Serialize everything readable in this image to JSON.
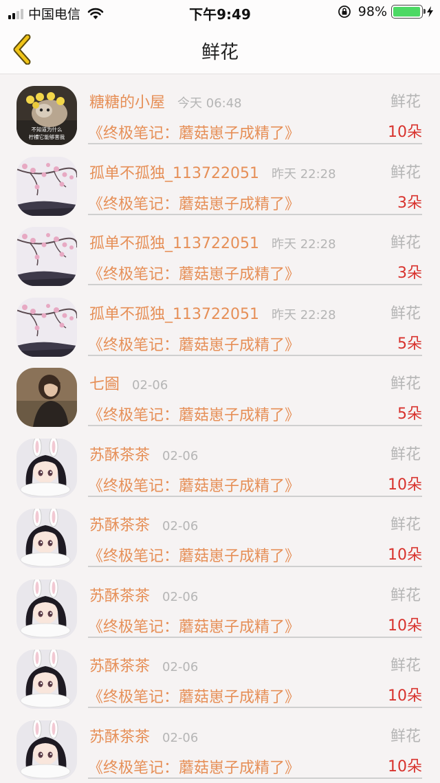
{
  "status_bar": {
    "carrier": "中国电信",
    "time": "下午9:49",
    "battery_percent": "98%",
    "battery_level": 0.98
  },
  "nav": {
    "title": "鲜花",
    "back_icon": "chevron-left-icon"
  },
  "colors": {
    "accent": "#f0c419",
    "username": "#e68f57",
    "count": "#d8322d",
    "muted": "#b5b5b5"
  },
  "rows": [
    {
      "avatar": "photo-dog-lemons",
      "avatar_caption": "不知道为什么 柠檬它能够害我",
      "name": "糖糖的小屋",
      "time": "今天 06:48",
      "gift": "鲜花",
      "book": "《终极笔记：蘑菇崽子成精了》",
      "count": "10朵"
    },
    {
      "avatar": "photo-cherry-blossom",
      "name": "孤单不孤独_113722051",
      "time": "昨天 22:28",
      "gift": "鲜花",
      "book": "《终极笔记：蘑菇崽子成精了》",
      "count": "3朵"
    },
    {
      "avatar": "photo-cherry-blossom",
      "name": "孤单不孤独_113722051",
      "time": "昨天 22:28",
      "gift": "鲜花",
      "book": "《终极笔记：蘑菇崽子成精了》",
      "count": "3朵"
    },
    {
      "avatar": "photo-cherry-blossom",
      "name": "孤单不孤独_113722051",
      "time": "昨天 22:28",
      "gift": "鲜花",
      "book": "《终极笔记：蘑菇崽子成精了》",
      "count": "5朵"
    },
    {
      "avatar": "photo-girl-portrait",
      "name": "七圇",
      "time": "02-06",
      "gift": "鲜花",
      "book": "《终极笔记：蘑菇崽子成精了》",
      "count": "5朵"
    },
    {
      "avatar": "anime-bunny-girl",
      "name": "苏酥茶茶",
      "time": "02-06",
      "gift": "鲜花",
      "book": "《终极笔记：蘑菇崽子成精了》",
      "count": "10朵"
    },
    {
      "avatar": "anime-bunny-girl",
      "name": "苏酥茶茶",
      "time": "02-06",
      "gift": "鲜花",
      "book": "《终极笔记：蘑菇崽子成精了》",
      "count": "10朵"
    },
    {
      "avatar": "anime-bunny-girl",
      "name": "苏酥茶茶",
      "time": "02-06",
      "gift": "鲜花",
      "book": "《终极笔记：蘑菇崽子成精了》",
      "count": "10朵"
    },
    {
      "avatar": "anime-bunny-girl",
      "name": "苏酥茶茶",
      "time": "02-06",
      "gift": "鲜花",
      "book": "《终极笔记：蘑菇崽子成精了》",
      "count": "10朵"
    },
    {
      "avatar": "anime-bunny-girl",
      "name": "苏酥茶茶",
      "time": "02-06",
      "gift": "鲜花",
      "book": "《终极笔记：蘑菇崽子成精了》",
      "count": "10朵"
    }
  ]
}
